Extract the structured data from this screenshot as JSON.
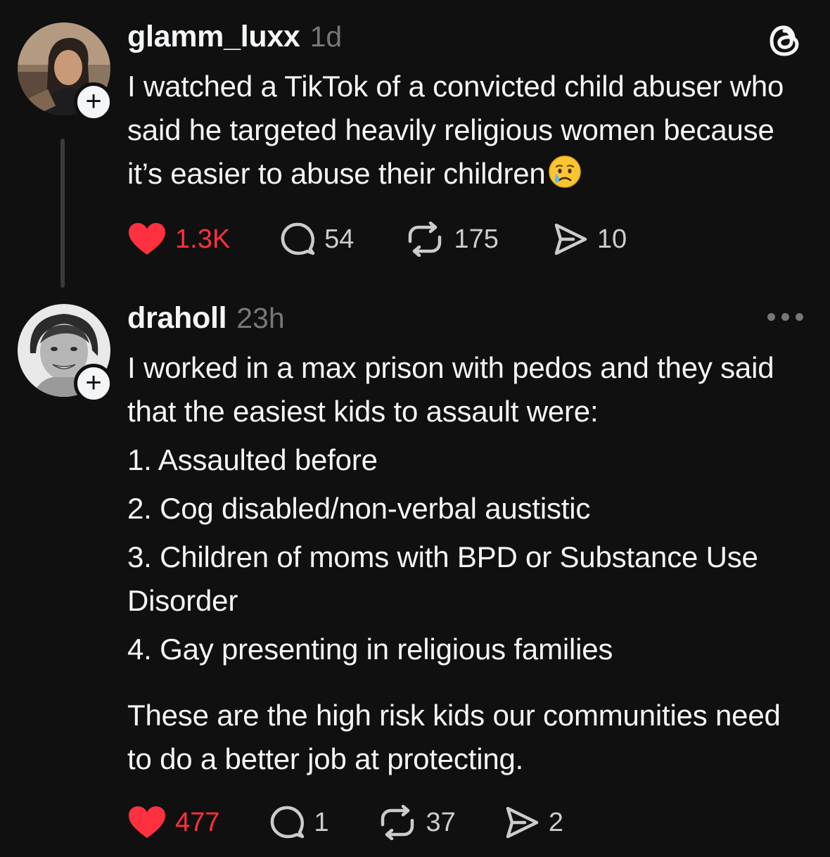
{
  "posts": [
    {
      "username": "glamm_luxx",
      "time": "1d",
      "text": "I watched a TikTok of a convicted child abuser who said he targeted heavily religious women because it’s easier to abuse their children",
      "emoji": "crying-face-emoji",
      "follow_label": "+",
      "likes": "1.3K",
      "replies": "54",
      "reposts": "175",
      "shares": "10"
    },
    {
      "username": "draholl",
      "time": "23h",
      "intro": "I worked in a max prison with pedos and they said that the easiest kids to assault were:",
      "list": [
        "1. Assaulted before",
        "2. Cog disabled/non-verbal austistic",
        "3. Children of moms with BPD or Substance Use Disorder",
        "4. Gay presenting in religious families"
      ],
      "closing": "These are the high risk kids our communities need to do a better job at protecting.",
      "follow_label": "+",
      "likes": "477",
      "replies": "1",
      "reposts": "37",
      "shares": "2"
    }
  ],
  "icons": [
    "threads-logo-icon",
    "more-icon",
    "heart-icon",
    "reply-icon",
    "repost-icon",
    "share-icon",
    "plus-icon"
  ],
  "colors": {
    "background": "#101010",
    "text": "#f3f5f7",
    "muted": "#777777",
    "like_red": "#ff3040",
    "thread_line": "#3a3a3a"
  }
}
